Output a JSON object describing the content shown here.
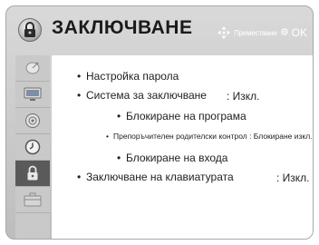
{
  "header": {
    "title": "ЗАКЛЮЧВАНЕ",
    "hint_move": "Преместване",
    "hint_ok": "OK",
    "lock_icon": "padlock-icon",
    "nav_icon": "navigation-arrows-icon"
  },
  "sidebar": {
    "items": [
      {
        "icon": "satellite-dish-icon"
      },
      {
        "icon": "tv-screen-icon"
      },
      {
        "icon": "speaker-icon"
      },
      {
        "icon": "clock-icon"
      },
      {
        "icon": "padlock-icon",
        "active": true
      },
      {
        "icon": "toolbox-icon"
      }
    ]
  },
  "menu": {
    "items": [
      {
        "label": "Настройка парола",
        "value": ""
      },
      {
        "label": "Система за заключване",
        "value": ": Изкл."
      },
      {
        "label": "Блокиране на програма",
        "value": ""
      },
      {
        "label": "Препоръчителен родителски контрол : Блокиране изкл.",
        "value": ""
      },
      {
        "label": "Блокиране на входа",
        "value": ""
      },
      {
        "label": "Заключване на клавиатурата",
        "value": ": Изкл."
      }
    ]
  },
  "colors": {
    "frame": "#c8c8c8",
    "panel": "#ffffff",
    "active_sidebar": "#5a5a5a"
  }
}
